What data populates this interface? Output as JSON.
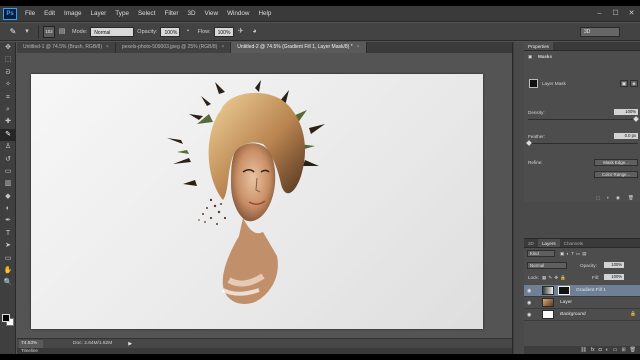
{
  "app": {
    "logo": "Ps"
  },
  "menu": [
    "File",
    "Edit",
    "Image",
    "Layer",
    "Type",
    "Select",
    "Filter",
    "3D",
    "View",
    "Window",
    "Help"
  ],
  "window_controls": [
    "–",
    "☐",
    "✕"
  ],
  "options_bar": {
    "brush_size": "102",
    "mode_label": "Mode:",
    "mode_value": "Normal",
    "opacity_label": "Opacity:",
    "opacity_value": "100%",
    "flow_label": "Flow:",
    "flow_value": "100%",
    "workspace_value": "3D"
  },
  "tabs": [
    {
      "title": "Untitled-1 @ 74.5% (Brush, RGB/8)",
      "active": false
    },
    {
      "title": "pexels-photo-509003.jpeg @ 25% (RGB/8)",
      "active": false
    },
    {
      "title": "Untitled-2 @ 74.5% (Gradient Fill 1, Layer Mask/8) *",
      "active": true
    }
  ],
  "status": {
    "zoom": "74.53%",
    "doc": "Doc: 2.64M/1.62M",
    "timeline": "Timeline"
  },
  "properties": {
    "tabs": [
      "Properties"
    ],
    "section": "Masks",
    "mask_type": "Layer Mask",
    "density_label": "Density:",
    "density_value": "100%",
    "feather_label": "Feather:",
    "feather_value": "0.0 px",
    "refine_label": "Refine:",
    "mask_edge_button": "Mask Edge...",
    "color_range_button": "Color Range..."
  },
  "layers_panel": {
    "tabs": [
      "3D",
      "Layers",
      "Channels"
    ],
    "kind_label": "Kind",
    "blend_mode": "Normal",
    "opacity_label": "Opacity:",
    "opacity_value": "100%",
    "lock_label": "Lock:",
    "fill_label": "Fill:",
    "fill_value": "100%",
    "layers": [
      {
        "name": "Gradient Fill 1",
        "selected": true
      },
      {
        "name": "Layer",
        "selected": false
      },
      {
        "name": "Background",
        "selected": false
      }
    ]
  },
  "colors": {
    "ui_dark": "#3a3a3a",
    "ui_mid": "#535353",
    "selected_layer": "#6f7f96",
    "ps_blue": "#31a8ff"
  }
}
